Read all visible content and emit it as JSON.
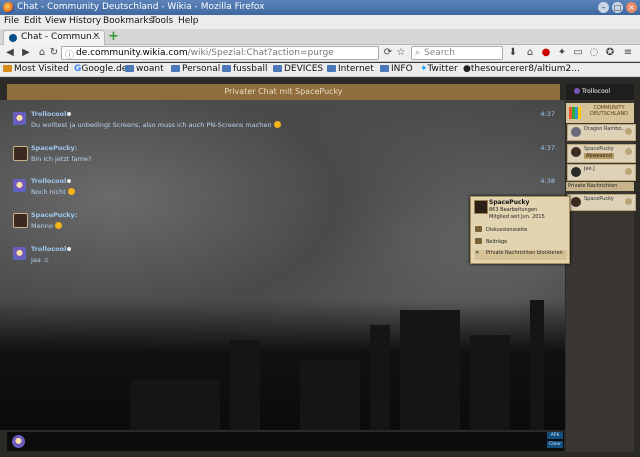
{
  "window": {
    "title": "Chat - Community Deutschland - Wikia - Mozilla Firefox"
  },
  "menu": [
    "File",
    "Edit",
    "View",
    "History",
    "Bookmarks",
    "Tools",
    "Help"
  ],
  "tab": {
    "label": "Chat - Commun...",
    "close": "×",
    "new": "+"
  },
  "nav": {
    "url_prefix": "",
    "url_domain": "de.community.wikia.com",
    "url_path": "/wiki/Spezial:Chat?action=purge",
    "search_placeholder": "Search"
  },
  "bookmarks": [
    "Most Visited",
    "Google.de",
    "woant",
    "Personal",
    "fussball",
    "DEVICES",
    "Internet",
    "INFO",
    "Twitter",
    "thesourcerer8/altium2..."
  ],
  "chat": {
    "header": "Privater Chat mit SpacePucky",
    "messages": [
      {
        "user": "Trollocool",
        "text": "Du wolltest ja unbedingt Screens, also muss ich auch PN-Screens machen",
        "time": "4:37",
        "avatar": "troll",
        "smile": true
      },
      {
        "user": "SpacePucky:",
        "text": "Bin ich jetzt fame?",
        "time": "4:37",
        "avatar": "space",
        "smile": false
      },
      {
        "user": "Trollocool",
        "text": "Noch nicht",
        "time": "4:38",
        "avatar": "troll",
        "smile": true
      },
      {
        "user": "SpacePucky:",
        "text": "Menno",
        "time": "",
        "avatar": "space",
        "smile": true
      },
      {
        "user": "Trollocool",
        "text": "Jaa :c",
        "time": "",
        "avatar": "troll",
        "smile": false
      }
    ]
  },
  "rail": {
    "current_user": "Trollocool",
    "logo_text": "COMMUNITY DEUTSCHLAND",
    "users": [
      {
        "name": "Dragon Rambo...",
        "badge": ""
      },
      {
        "name": "SpacePucky",
        "badge": "Abwesend"
      },
      {
        "name": "Jee J",
        "badge": ""
      }
    ],
    "private_header": "Private Nachrichten",
    "private_users": [
      {
        "name": "SpacePucky"
      }
    ]
  },
  "popup": {
    "name": "SpacePucky",
    "edits": "863 Bearbeitungen",
    "since": "Mitglied seit Jun. 2015",
    "options": [
      "Diskussionsseite",
      "Beiträge",
      "Private Nachrichten blockieren"
    ]
  },
  "input": {
    "afk": "AFK",
    "clear": "Clear"
  }
}
